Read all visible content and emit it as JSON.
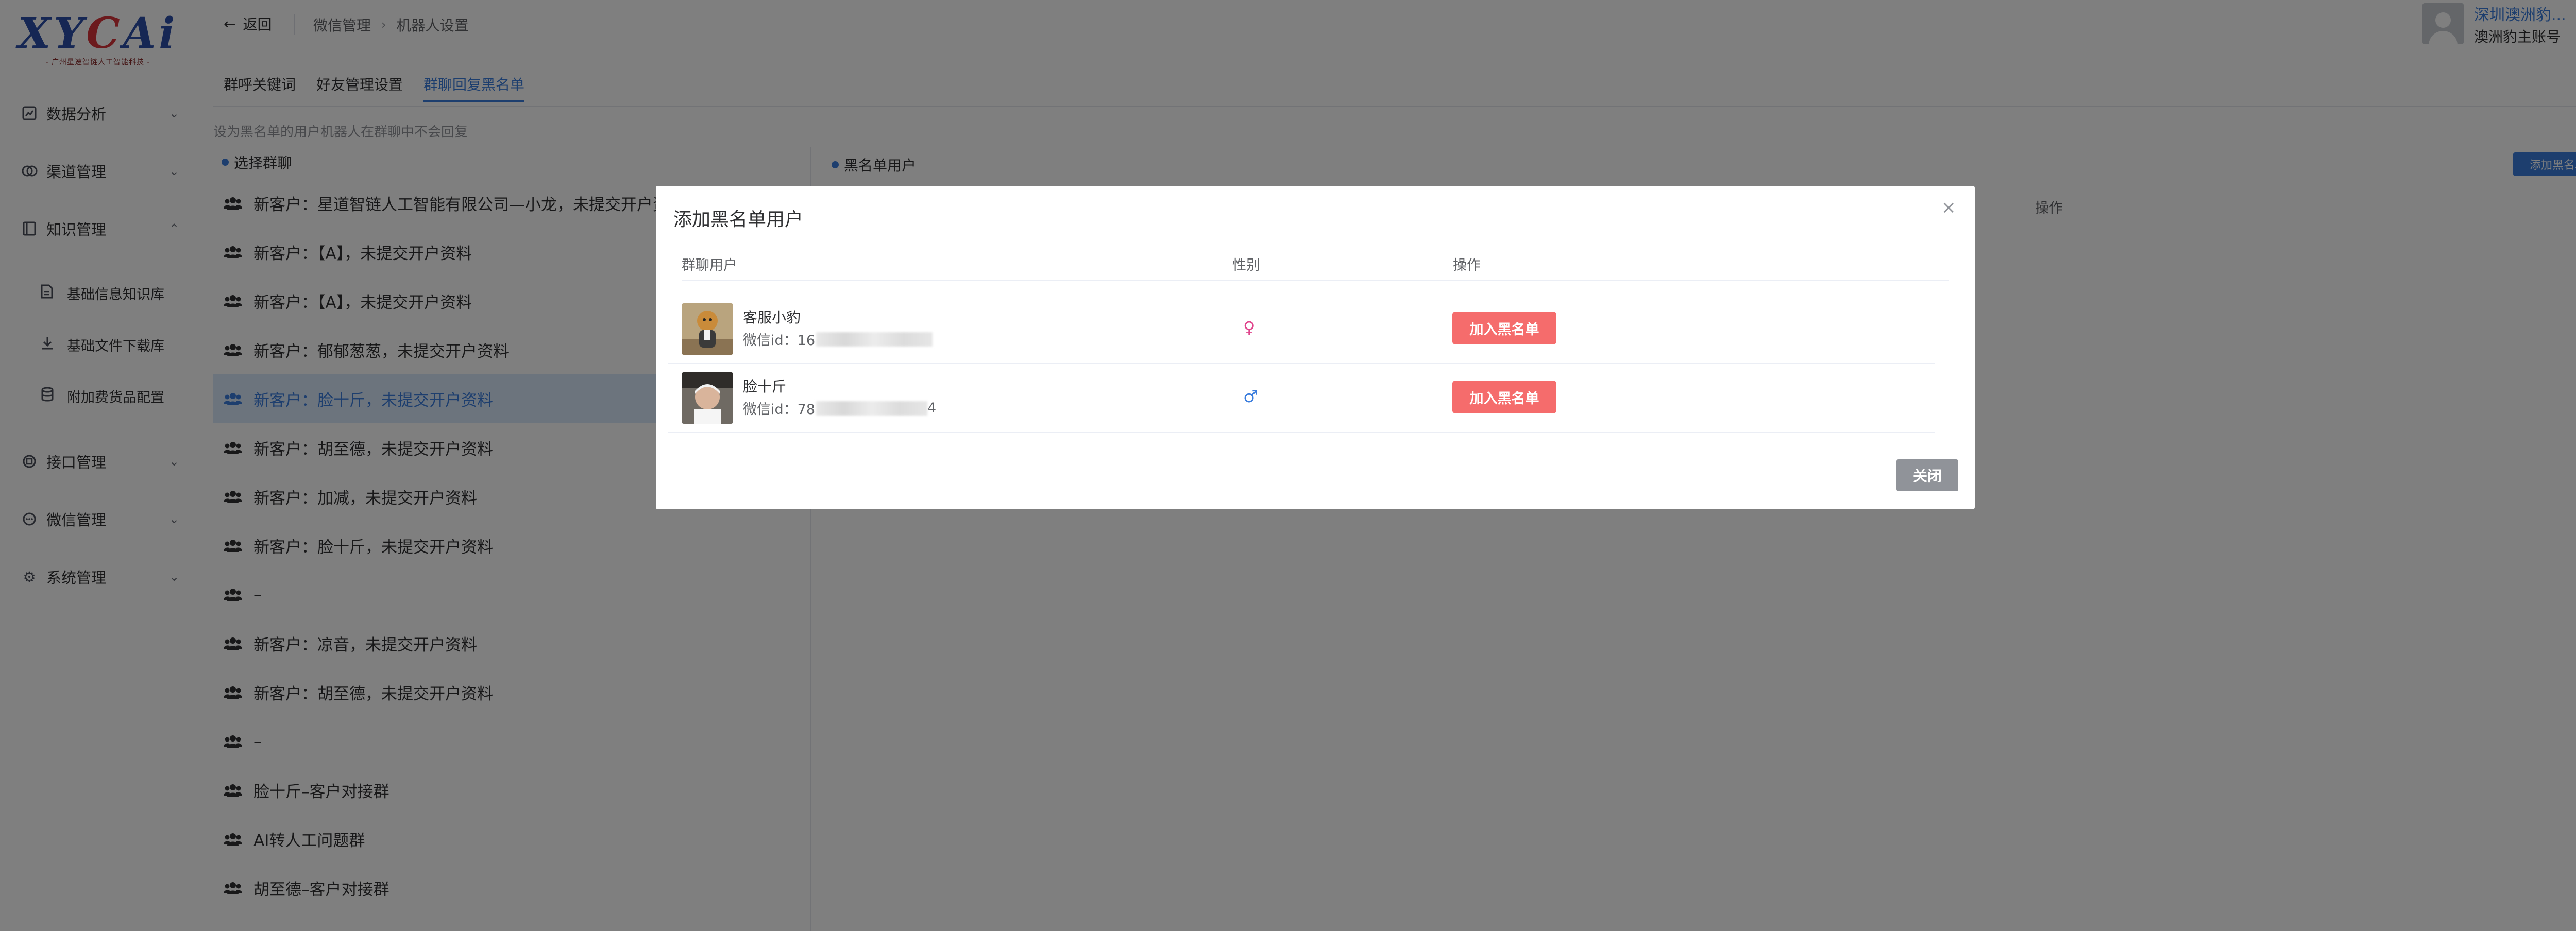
{
  "logo": {
    "text_a": "XY",
    "text_y": "C",
    "text_b": "Ai",
    "subtitle": "- 广州星速智链人工智能科技 -"
  },
  "sidebar": {
    "items": [
      {
        "label": "数据分析",
        "icon": "chart-icon"
      },
      {
        "label": "渠道管理",
        "icon": "channel-icon"
      },
      {
        "label": "知识管理",
        "icon": "book-icon",
        "expanded": true
      },
      {
        "label": "基础信息知识库",
        "icon": "document-icon",
        "sub": true
      },
      {
        "label": "基础文件下载库",
        "icon": "download-icon",
        "sub": true
      },
      {
        "label": "附加费货品配置",
        "icon": "database-icon",
        "sub": true
      },
      {
        "label": "接口管理",
        "icon": "interface-icon"
      },
      {
        "label": "微信管理",
        "icon": "chat-icon"
      },
      {
        "label": "系统管理",
        "icon": "gear-icon"
      }
    ]
  },
  "header": {
    "back_label": "返回",
    "breadcrumb": [
      "微信管理",
      "机器人设置"
    ],
    "user_name": "深圳澳洲豹...",
    "user_account": "澳洲豹主账号"
  },
  "tabs": [
    {
      "label": "群呼关键词"
    },
    {
      "label": "好友管理设置"
    },
    {
      "label": "群聊回复黑名单",
      "active": true
    }
  ],
  "hint": "设为黑名单的用户机器人在群聊中不会回复",
  "left_panel": {
    "title": "选择群聊",
    "groups": [
      "新客户：星道智链人工智能有限公司—小龙，未提交开户资料",
      "新客户：【A】，未提交开户资料",
      "新客户：【A】，未提交开户资料",
      "新客户：郁郁葱葱，未提交开户资料",
      "新客户：脸十斤，未提交开户资料",
      "新客户：胡至德，未提交开户资料",
      "新客户：加减，未提交开户资料",
      "新客户：脸十斤，未提交开户资料",
      "–",
      "新客户：凉音，未提交开户资料",
      "新客户：胡至德，未提交开户资料",
      "–",
      "脸十斤–客户对接群",
      "AI转人工问题群",
      "胡至德–客户对接群"
    ],
    "active_index": 4
  },
  "right_panel": {
    "title": "黑名单用户",
    "add_button": "添加黑名单用户",
    "column_action": "操作"
  },
  "modal": {
    "title": "添加黑名单用户",
    "columns": {
      "user": "群聊用户",
      "gender": "性别",
      "action": "操作"
    },
    "rows": [
      {
        "name": "客服小豹",
        "wx_prefix": "微信id：16",
        "wx_suffix": "",
        "gender": "♀",
        "gender_color": "#e0448c",
        "action": "加入黑名单"
      },
      {
        "name": "脸十斤",
        "wx_prefix": "微信id：78",
        "wx_suffix": "4",
        "gender": "♂",
        "gender_color": "#3b7ddd",
        "action": "加入黑名单"
      }
    ],
    "close_button": "关闭"
  },
  "colors": {
    "accent": "#3b7ddd",
    "danger": "#f56c6c",
    "neutral_button": "#909399"
  }
}
